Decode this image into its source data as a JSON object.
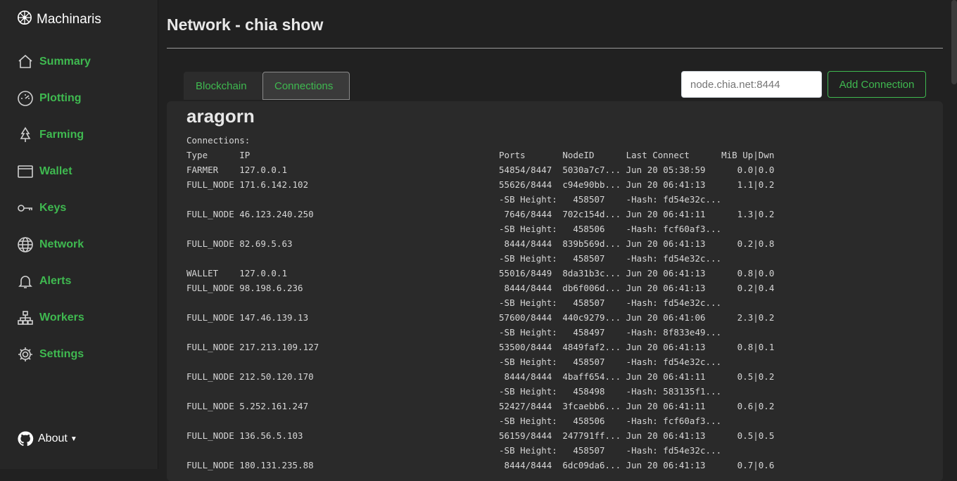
{
  "app": {
    "name": "Machinaris"
  },
  "nav": [
    {
      "label": "Summary",
      "icon": "house-icon"
    },
    {
      "label": "Plotting",
      "icon": "gauge-icon"
    },
    {
      "label": "Farming",
      "icon": "tree-icon"
    },
    {
      "label": "Wallet",
      "icon": "wallet-icon"
    },
    {
      "label": "Keys",
      "icon": "key-icon"
    },
    {
      "label": "Network",
      "icon": "globe-icon"
    },
    {
      "label": "Alerts",
      "icon": "bell-icon"
    },
    {
      "label": "Workers",
      "icon": "diagram-icon"
    },
    {
      "label": "Settings",
      "icon": "gear-icon"
    }
  ],
  "about": {
    "label": "About",
    "icon": "github-icon"
  },
  "page": {
    "title": "Network - chia show"
  },
  "tabs": [
    {
      "label": "Blockchain",
      "active": false
    },
    {
      "label": "Connections",
      "active": true
    }
  ],
  "connection_form": {
    "placeholder": "node.chia.net:8444",
    "button_label": "Add Connection"
  },
  "worker": {
    "hostname": "aragorn"
  },
  "connections": {
    "heading": "Connections:",
    "columns": [
      "Type",
      "IP",
      "Ports",
      "NodeID",
      "Last Connect",
      "MiB Up|Dwn"
    ],
    "rows": [
      {
        "type": "FARMER",
        "ip": "127.0.0.1",
        "ports": "54854/8447",
        "node_id": "5030a7c7...",
        "last_connect": "Jun 20 05:38:59",
        "mib": "0.0|0.0"
      },
      {
        "type": "FULL_NODE",
        "ip": "171.6.142.102",
        "ports": "55626/8444",
        "node_id": "c94e90bb...",
        "last_connect": "Jun 20 06:41:13",
        "mib": "1.1|0.2",
        "sb_height": "458507",
        "hash": "fd54e32c..."
      },
      {
        "type": "FULL_NODE",
        "ip": "46.123.240.250",
        "ports": "7646/8444",
        "node_id": "702c154d...",
        "last_connect": "Jun 20 06:41:11",
        "mib": "1.3|0.2",
        "sb_height": "458506",
        "hash": "fcf60af3..."
      },
      {
        "type": "FULL_NODE",
        "ip": "82.69.5.63",
        "ports": "8444/8444",
        "node_id": "839b569d...",
        "last_connect": "Jun 20 06:41:13",
        "mib": "0.2|0.8",
        "sb_height": "458507",
        "hash": "fd54e32c..."
      },
      {
        "type": "WALLET",
        "ip": "127.0.0.1",
        "ports": "55016/8449",
        "node_id": "8da31b3c...",
        "last_connect": "Jun 20 06:41:13",
        "mib": "0.8|0.0"
      },
      {
        "type": "FULL_NODE",
        "ip": "98.198.6.236",
        "ports": "8444/8444",
        "node_id": "db6f006d...",
        "last_connect": "Jun 20 06:41:13",
        "mib": "0.2|0.4",
        "sb_height": "458507",
        "hash": "fd54e32c..."
      },
      {
        "type": "FULL_NODE",
        "ip": "147.46.139.13",
        "ports": "57600/8444",
        "node_id": "440c9279...",
        "last_connect": "Jun 20 06:41:06",
        "mib": "2.3|0.2",
        "sb_height": "458497",
        "hash": "8f833e49..."
      },
      {
        "type": "FULL_NODE",
        "ip": "217.213.109.127",
        "ports": "53500/8444",
        "node_id": "4849faf2...",
        "last_connect": "Jun 20 06:41:13",
        "mib": "0.8|0.1",
        "sb_height": "458507",
        "hash": "fd54e32c..."
      },
      {
        "type": "FULL_NODE",
        "ip": "212.50.120.170",
        "ports": "8444/8444",
        "node_id": "4baff654...",
        "last_connect": "Jun 20 06:41:11",
        "mib": "0.5|0.2",
        "sb_height": "458498",
        "hash": "583135f1..."
      },
      {
        "type": "FULL_NODE",
        "ip": "5.252.161.247",
        "ports": "52427/8444",
        "node_id": "3fcaebb6...",
        "last_connect": "Jun 20 06:41:11",
        "mib": "0.6|0.2",
        "sb_height": "458506",
        "hash": "fcf60af3..."
      },
      {
        "type": "FULL_NODE",
        "ip": "136.56.5.103",
        "ports": "56159/8444",
        "node_id": "247791ff...",
        "last_connect": "Jun 20 06:41:13",
        "mib": "0.5|0.5",
        "sb_height": "458507",
        "hash": "fd54e32c..."
      },
      {
        "type": "FULL_NODE",
        "ip": "180.131.235.88",
        "ports": "8444/8444",
        "node_id": "6dc09da6...",
        "last_connect": "Jun 20 06:41:13",
        "mib": "0.7|0.6"
      }
    ]
  }
}
